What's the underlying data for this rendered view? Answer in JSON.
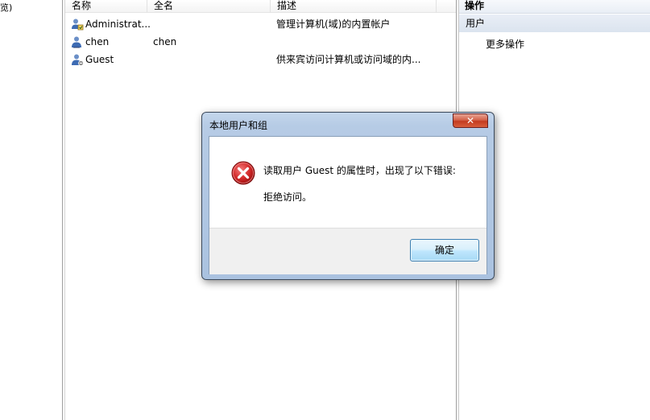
{
  "tree": {
    "fragment": "览)"
  },
  "list": {
    "columns": [
      "名称",
      "全名",
      "描述"
    ],
    "rows": [
      {
        "name": "Administrat...",
        "fullname": "",
        "description": "管理计算机(域)的内置帐户"
      },
      {
        "name": "chen",
        "fullname": "chen",
        "description": ""
      },
      {
        "name": "Guest",
        "fullname": "",
        "description": "供来宾访问计算机或访问域的内..."
      }
    ]
  },
  "actions": {
    "header": "操作",
    "section": "用户",
    "more": "更多操作"
  },
  "dialog": {
    "title": "本地用户和组",
    "close_glyph": "✕",
    "message": "读取用户 Guest 的属性时，出现了以下错误:",
    "detail": "拒绝访问。",
    "ok_label": "确定"
  },
  "colors": {
    "error_red": "#d42a2a",
    "dialog_frame": "#b6cbe5",
    "close_red": "#c43b1f"
  }
}
